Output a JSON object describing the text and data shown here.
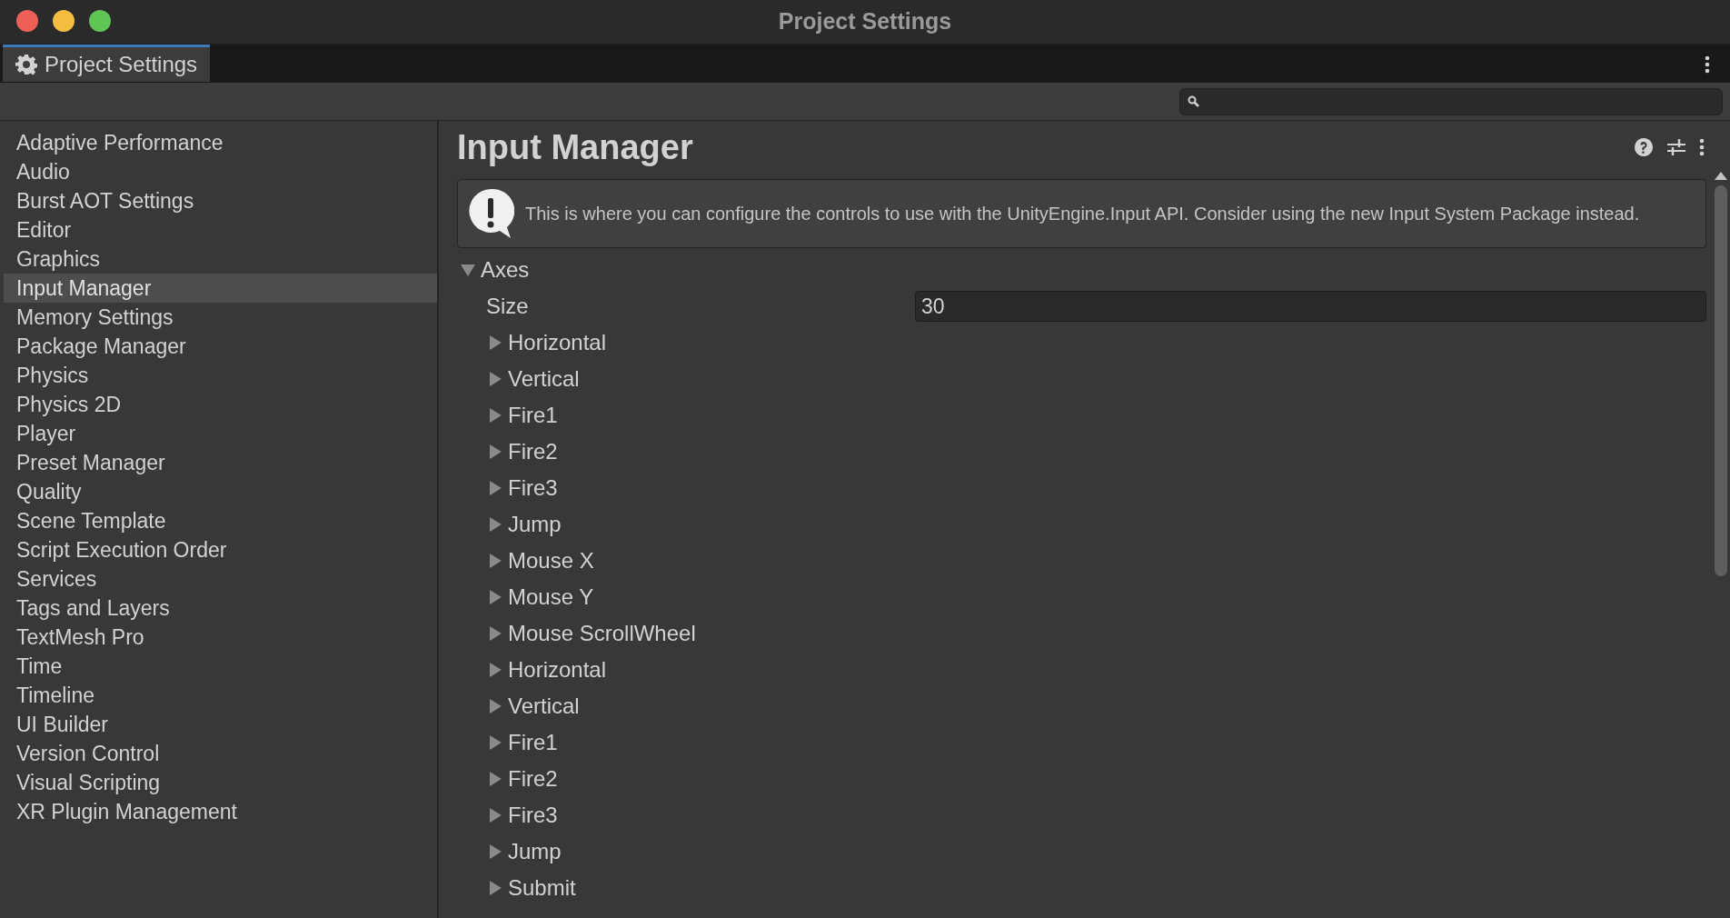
{
  "window": {
    "title": "Project Settings"
  },
  "tabs": [
    {
      "label": "Project Settings",
      "selected": true
    }
  ],
  "sidebar": {
    "items": [
      {
        "label": "Adaptive Performance",
        "selected": false
      },
      {
        "label": "Audio",
        "selected": false
      },
      {
        "label": "Burst AOT Settings",
        "selected": false
      },
      {
        "label": "Editor",
        "selected": false
      },
      {
        "label": "Graphics",
        "selected": false
      },
      {
        "label": "Input Manager",
        "selected": true
      },
      {
        "label": "Memory Settings",
        "selected": false
      },
      {
        "label": "Package Manager",
        "selected": false
      },
      {
        "label": "Physics",
        "selected": false
      },
      {
        "label": "Physics 2D",
        "selected": false
      },
      {
        "label": "Player",
        "selected": false
      },
      {
        "label": "Preset Manager",
        "selected": false
      },
      {
        "label": "Quality",
        "selected": false
      },
      {
        "label": "Scene Template",
        "selected": false
      },
      {
        "label": "Script Execution Order",
        "selected": false
      },
      {
        "label": "Services",
        "selected": false
      },
      {
        "label": "Tags and Layers",
        "selected": false
      },
      {
        "label": "TextMesh Pro",
        "selected": false
      },
      {
        "label": "Time",
        "selected": false
      },
      {
        "label": "Timeline",
        "selected": false
      },
      {
        "label": "UI Builder",
        "selected": false
      },
      {
        "label": "Version Control",
        "selected": false
      },
      {
        "label": "Visual Scripting",
        "selected": false
      },
      {
        "label": "XR Plugin Management",
        "selected": false
      }
    ]
  },
  "panel": {
    "title": "Input Manager",
    "info": "This is where you can configure the controls to use with the UnityEngine.Input API. Consider using the new Input System Package instead.",
    "axes": {
      "label": "Axes",
      "expanded": true,
      "size_label": "Size",
      "size_value": "30",
      "children": [
        {
          "label": "Horizontal",
          "expanded": false
        },
        {
          "label": "Vertical",
          "expanded": false
        },
        {
          "label": "Fire1",
          "expanded": false
        },
        {
          "label": "Fire2",
          "expanded": false
        },
        {
          "label": "Fire3",
          "expanded": false
        },
        {
          "label": "Jump",
          "expanded": false
        },
        {
          "label": "Mouse X",
          "expanded": false
        },
        {
          "label": "Mouse Y",
          "expanded": false
        },
        {
          "label": "Mouse ScrollWheel",
          "expanded": false
        },
        {
          "label": "Horizontal",
          "expanded": false
        },
        {
          "label": "Vertical",
          "expanded": false
        },
        {
          "label": "Fire1",
          "expanded": false
        },
        {
          "label": "Fire2",
          "expanded": false
        },
        {
          "label": "Fire3",
          "expanded": false
        },
        {
          "label": "Jump",
          "expanded": false
        },
        {
          "label": "Submit",
          "expanded": false
        }
      ]
    }
  }
}
